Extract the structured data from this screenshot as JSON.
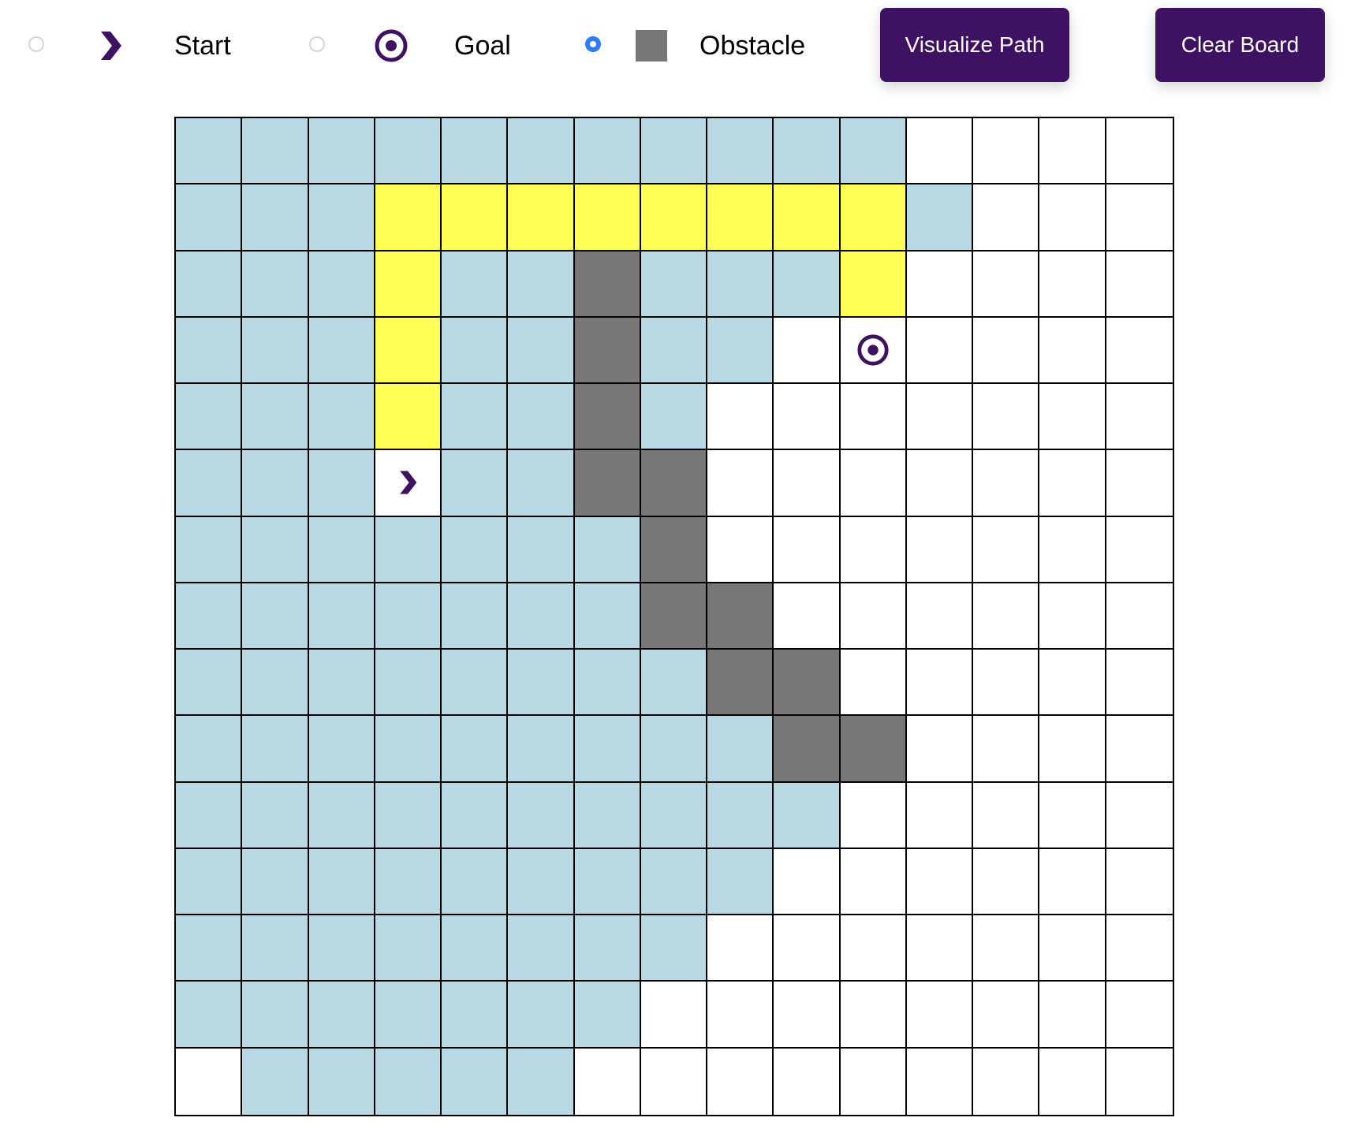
{
  "legend": {
    "start": {
      "label": "Start",
      "icon": "chevron-right-icon",
      "selected": false
    },
    "goal": {
      "label": "Goal",
      "icon": "target-icon",
      "selected": false
    },
    "obstacle": {
      "label": "Obstacle",
      "icon": "gray-square-icon",
      "selected": true
    }
  },
  "buttons": {
    "visualize": "Visualize Path",
    "clear": "Clear Board"
  },
  "colors": {
    "accent": "#3e1163",
    "visited": "#b8d8e4",
    "path": "#ffff55",
    "wall": "#777777",
    "empty": "#ffffff",
    "radio_selected": "#2e7cf6"
  },
  "grid": {
    "rows": 15,
    "cols": 15,
    "legend_codes": {
      "E": "empty",
      "V": "visited",
      "P": "path",
      "W": "wall",
      "S": "start",
      "G": "goal"
    },
    "cells": [
      "VVVVVVVVVVVEEEE",
      "VVVPPPPPPPPVEEE",
      "VVVPVVWVVVPEEEE",
      "VVVPVVWVVEGEEEE",
      "VVVPVVWVEEEEEEE",
      "VVVSVVWWEEEEEEE",
      "VVVVVVVWEEEEEEE",
      "VVVVVVVWWEEEEEE",
      "VVVVVVVVWWEEEEE",
      "VVVVVVVVVWWEEEE",
      "VVVVVVVVVVEEEEE",
      "VVVVVVVVVEEEEEE",
      "VVVVVVVVEEEEEEE",
      "VVVVVVVEEEEEEEE",
      "EVVVVVEEEEEEEEE"
    ]
  }
}
